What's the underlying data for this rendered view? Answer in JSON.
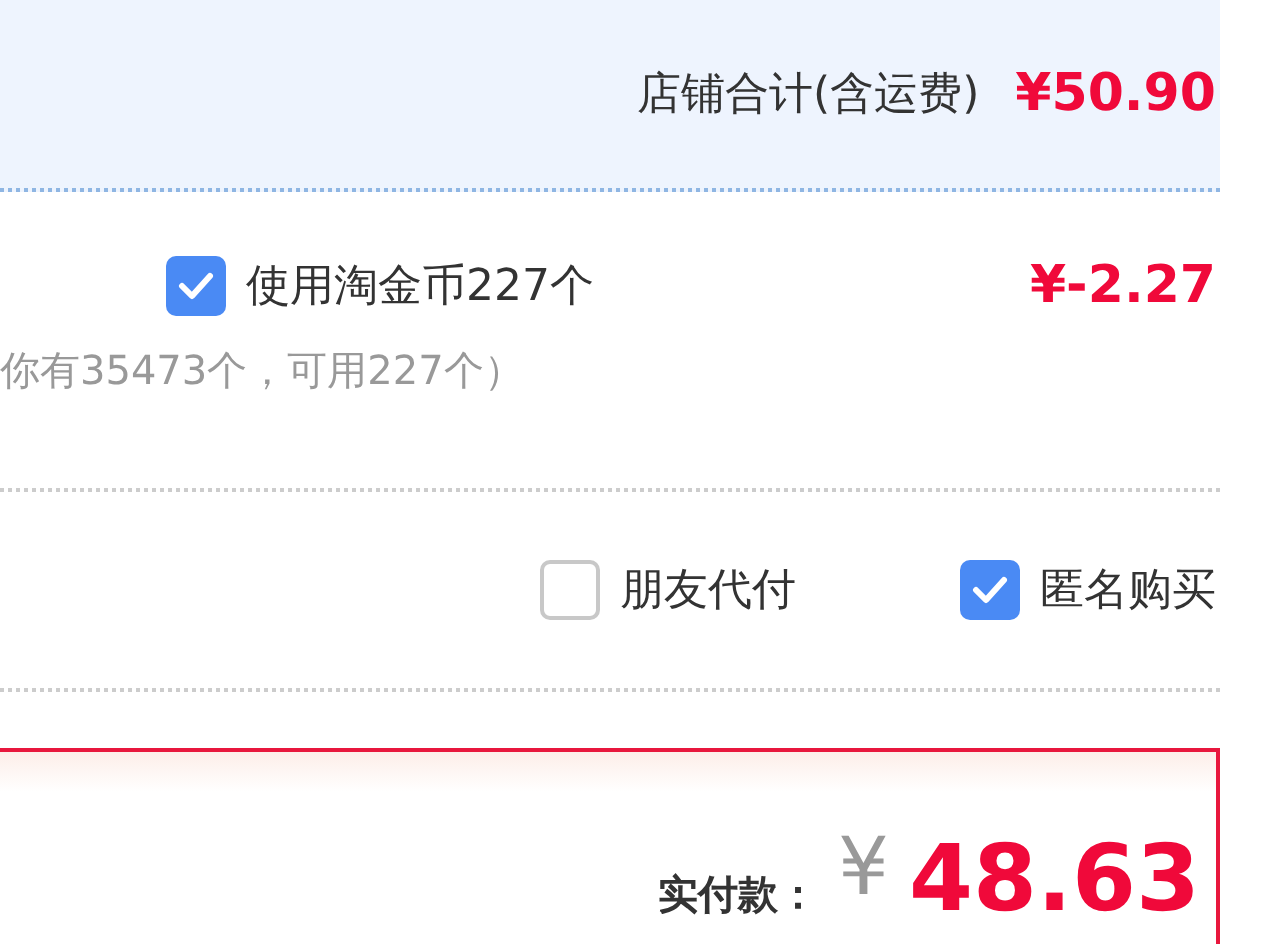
{
  "shop_total": {
    "label": "店铺合计(含运费)",
    "amount": "¥50.90"
  },
  "coins": {
    "label": "使用淘金币227个",
    "checked": true,
    "amount": "¥-2.27",
    "note": "你有35473个，可用227个）"
  },
  "options": [
    {
      "label": "朋友代付",
      "checked": false
    },
    {
      "label": "匿名购买",
      "checked": true
    }
  ],
  "payment": {
    "label": "实付款：",
    "currency": "¥",
    "amount": "48.63"
  }
}
